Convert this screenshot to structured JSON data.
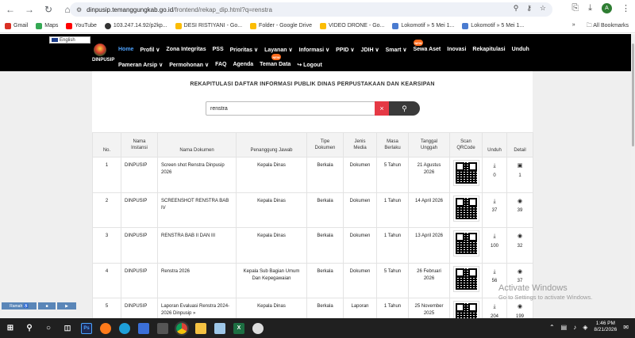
{
  "browser": {
    "url_host": "dinpusip.temanggungkab.go.id",
    "url_path": "/frontend/rekap_dip.html?q=renstra",
    "avatar_letter": "A",
    "bookmarks": [
      {
        "label": "Gmail",
        "color": "#d93025"
      },
      {
        "label": "Maps",
        "color": "#34a853"
      },
      {
        "label": "YouTube",
        "color": "#ff0000"
      },
      {
        "label": "103.247.14.92/p2kp...",
        "color": "#333333"
      },
      {
        "label": "DESI RISTIYANI - Go...",
        "color": "#fbbc04"
      },
      {
        "label": "Folder - Google Drive",
        "color": "#fbbc04"
      },
      {
        "label": "VIDEO DRONE - Go...",
        "color": "#fbbc04"
      },
      {
        "label": "Lokomotif » 5 Mei 1...",
        "color": "#4a7bd0"
      },
      {
        "label": "Lokomotif » 5 Mei 1...",
        "color": "#4a7bd0"
      }
    ],
    "more_bookmarks": "»",
    "all_bookmarks": "All Bookmarks"
  },
  "site": {
    "language": "English",
    "logo_text": "DINPUSIP",
    "nav_row1": [
      {
        "label": "Home",
        "active": true
      },
      {
        "label": "Profil ∨"
      },
      {
        "label": "Zona Integritas"
      },
      {
        "label": "PSS"
      },
      {
        "label": "Prioritas ∨"
      },
      {
        "label": "Layanan ∨"
      },
      {
        "label": "Informasi ∨"
      },
      {
        "label": "PPID ∨"
      },
      {
        "label": "JDIH ∨"
      },
      {
        "label": "Smart ∨"
      },
      {
        "label": "Sewa Aset"
      },
      {
        "label": "Inovasi"
      },
      {
        "label": "Rekapitulasi"
      },
      {
        "label": "Unduh"
      }
    ],
    "nav_row2": [
      {
        "label": "Pameran Arsip ∨"
      },
      {
        "label": "Permohonan ∨"
      },
      {
        "label": "FAQ"
      },
      {
        "label": "Agenda"
      },
      {
        "label": "Teman Data"
      },
      {
        "label": "↪ Logout"
      }
    ],
    "new_badge": "NEW"
  },
  "page": {
    "title": "REKAPITULASI DAFTAR INFORMASI PUBLIK DINAS PERPUSTAKAAN DAN KEARSIPAN",
    "search_value": "renstra",
    "clear_label": "×",
    "search_icon": "⚲"
  },
  "table": {
    "headers": [
      "No.",
      "Nama\nInstansi",
      "Nama Dokumen",
      "Penanggung Jawab",
      "Tipe\nDokumen",
      "Jenis\nMedia",
      "Masa\nBerlaku",
      "Tanggal\nUnggah",
      "Scan\nQRCode",
      "Unduh",
      "Detail"
    ],
    "rows": [
      {
        "no": "1",
        "instansi": "DINPUSIP",
        "dokumen": "Screen shot Renstra Dinpusip 2026",
        "pj": "Kepala Dinas",
        "tipe": "Berkala",
        "media": "Dokumen",
        "masa": "5 Tahun",
        "tanggal": "21 Agustus 2026",
        "unduh": "0",
        "detail": "1",
        "detail_icon": "▣"
      },
      {
        "no": "2",
        "instansi": "DINPUSIP",
        "dokumen": "SCREENSHOT RENSTRA BAB IV",
        "pj": "Kepala Dinas",
        "tipe": "Berkala",
        "media": "Dokumen",
        "masa": "1 Tahun",
        "tanggal": "14 April 2026",
        "unduh": "37",
        "detail": "39",
        "detail_icon": "◉"
      },
      {
        "no": "3",
        "instansi": "DINPUSIP",
        "dokumen": "RENSTRA BAB II DAN III",
        "pj": "Kepala Dinas",
        "tipe": "Berkala",
        "media": "Dokumen",
        "masa": "1 Tahun",
        "tanggal": "13 April 2026",
        "unduh": "100",
        "detail": "32",
        "detail_icon": "◉"
      },
      {
        "no": "4",
        "instansi": "DINPUSIP",
        "dokumen": "Renstra 2026",
        "pj": "Kepala Sub Bagian Umum Dan Kepegawaian",
        "tipe": "Berkala",
        "media": "Dokumen",
        "masa": "5 Tahun",
        "tanggal": "26 Februari 2026",
        "unduh": "56",
        "detail": "37",
        "detail_icon": "◉"
      },
      {
        "no": "5",
        "instansi": "DINPUSIP",
        "dokumen": "Laporan Evaluasi Renstra 2024-2026 Dinpusip »",
        "pj": "Kepala Dinas",
        "tipe": "Berkala",
        "media": "Laporan",
        "masa": "1 Tahun",
        "tanggal": "25 November 2025",
        "unduh": "204",
        "detail": "199",
        "detail_icon": "◉"
      }
    ],
    "download_icon": "⤓"
  },
  "overlay": {
    "watermark_title": "Activate Windows",
    "watermark_sub": "Go to Settings to activate Windows.",
    "accessibility": [
      "Ramah ♿",
      "■",
      "▶"
    ]
  },
  "taskbar": {
    "time": "1:46 PM",
    "date": "8/21/2026"
  }
}
